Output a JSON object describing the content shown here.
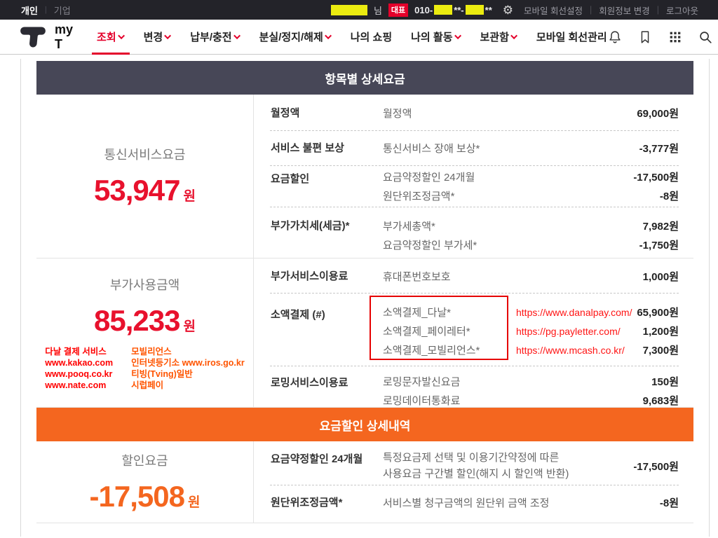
{
  "topbar": {
    "personal": "개인",
    "business": "기업",
    "user": {
      "suffix": "님",
      "badge": "대표",
      "phone_prefix": "010-",
      "mask1": "**-",
      "mask2": "**"
    },
    "links": {
      "line_settings": "모바일 회선설정",
      "member_info": "회원정보 변경",
      "logout": "로그아웃"
    }
  },
  "nav": {
    "brand": "my T",
    "items": [
      {
        "label": "조회"
      },
      {
        "label": "변경"
      },
      {
        "label": "납부/충전"
      },
      {
        "label": "분실/정지/해제"
      },
      {
        "label": "나의 쇼핑"
      },
      {
        "label": "나의 활동"
      },
      {
        "label": "보관함"
      },
      {
        "label": "모바일 회선관리"
      }
    ]
  },
  "main": {
    "band1": "항목별 상세요금",
    "band2": "요금할인 상세내역",
    "s1": {
      "summary": {
        "title": "통신서비스요금",
        "amount": "53,947",
        "unit": "원"
      },
      "rows": [
        {
          "label": "월정액",
          "items": [
            {
              "name": "월정액",
              "value": "69,000원"
            }
          ]
        },
        {
          "label": "서비스 불편 보상",
          "items": [
            {
              "name": "통신서비스 장애 보상*",
              "value": "-3,777원"
            }
          ]
        },
        {
          "label": "요금할인",
          "items": [
            {
              "name": "요금약정할인 24개월",
              "value": "-17,500원"
            },
            {
              "name": "원단위조정금액*",
              "value": "-8원"
            }
          ]
        },
        {
          "label": "부가가치세(세금)*",
          "items": [
            {
              "name": "부가세총액*",
              "value": "7,982원"
            },
            {
              "name": "요금약정할인 부가세*",
              "value": "-1,750원"
            }
          ]
        }
      ]
    },
    "s2": {
      "summary": {
        "title": "부가사용금액",
        "amount": "85,233",
        "unit": "원"
      },
      "ann_red": {
        "a": "다날 결제 서비스",
        "b": "www.kakao.com",
        "c": "www.pooq.co.kr",
        "d": "www.nate.com"
      },
      "ann_orange": {
        "a": "모빌리언스",
        "b": "인터넷등기소 www.iros.go.kr",
        "c": "티빙(Tving)일반",
        "d": "시럽페이"
      },
      "row1": {
        "label": "부가서비스이용료",
        "name": "휴대폰번호보호",
        "value": "1,000원"
      },
      "micro": {
        "label": "소액결제 (#)",
        "items": [
          {
            "name": "소액결제_다날*",
            "url": "https://www.danalpay.com/",
            "value": "65,900원"
          },
          {
            "name": "소액결제_페이레터*",
            "url": "https://pg.payletter.com/",
            "value": "1,200원"
          },
          {
            "name": "소액결제_모빌리언스*",
            "url": "https://www.mcash.co.kr/",
            "value": "7,300원"
          }
        ]
      },
      "row3": {
        "label": "로밍서비스이용료",
        "items": [
          {
            "name": "로밍문자발신요금",
            "value": "150원"
          },
          {
            "name": "로밍데이터통화료",
            "value": "9,683원"
          }
        ]
      }
    },
    "s3": {
      "summary": {
        "title": "할인요금",
        "amount": "-17,508",
        "unit": "원"
      },
      "row1": {
        "label": "요금약정할인 24개월",
        "desc1": "특정요금제 선택 및 이용기간약정에 따른",
        "desc2": "사용요금 구간별 할인(해지 시 할인액 반환)",
        "value": "-17,500원"
      },
      "row2": {
        "label": "원단위조정금액*",
        "desc": "서비스별 청구금액의 원단위 금액 조정",
        "value": "-8원"
      }
    }
  },
  "colors": {
    "accent_red": "#e4002b",
    "band_purple": "#474757",
    "band_orange": "#f4661f",
    "amount_red": "#e8112d",
    "annotation_red": "#ff0000",
    "annotation_orange": "#ff5400",
    "url_red": "#ff1414",
    "redaction_yellow": "#ebeb10"
  }
}
